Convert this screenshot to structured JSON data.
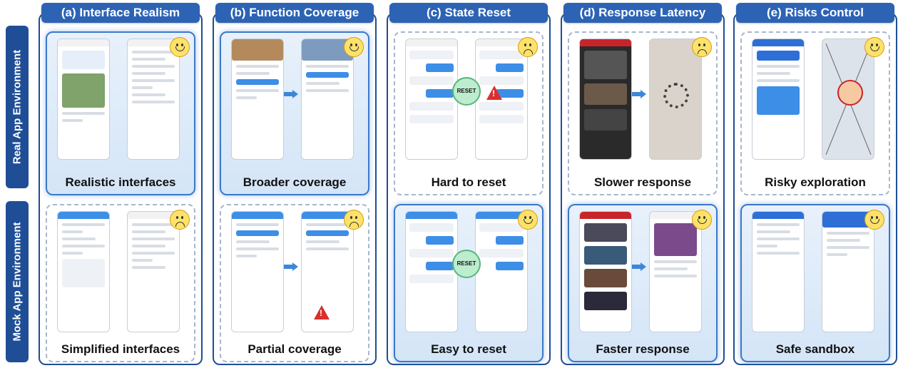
{
  "row_labels": [
    "Real App Environment",
    "Mock App Environment"
  ],
  "columns": [
    {
      "header": "(a) Interface Realism",
      "top_caption": "Realistic interfaces",
      "top_face": "happy",
      "bottom_caption": "Simplified interfaces",
      "bottom_face": "sad"
    },
    {
      "header": "(b) Function Coverage",
      "top_caption": "Broader coverage",
      "top_face": "happy",
      "bottom_caption": "Partial coverage",
      "bottom_face": "sad"
    },
    {
      "header": "(c) State Reset",
      "top_caption": "Hard to reset",
      "top_face": "sad",
      "bottom_caption": "Easy to reset",
      "bottom_face": "happy"
    },
    {
      "header": "(d) Response Latency",
      "top_caption": "Slower response",
      "top_face": "sad",
      "bottom_caption": "Faster response",
      "bottom_face": "happy"
    },
    {
      "header": "(e) Risks Control",
      "top_caption": "Risky exploration",
      "top_face": "happy",
      "bottom_caption": "Safe sandbox",
      "bottom_face": "happy"
    }
  ],
  "reset_label": "RESET",
  "icons": [
    "happy-face-icon",
    "sad-face-icon",
    "reset-cycle-icon",
    "warning-triangle-icon",
    "loading-spinner-icon",
    "tap-hand-icon"
  ],
  "colors": {
    "accent": "#2d63b5",
    "frame": "#1f4e96",
    "warning": "#d9302c",
    "reset": "#58b67b"
  }
}
